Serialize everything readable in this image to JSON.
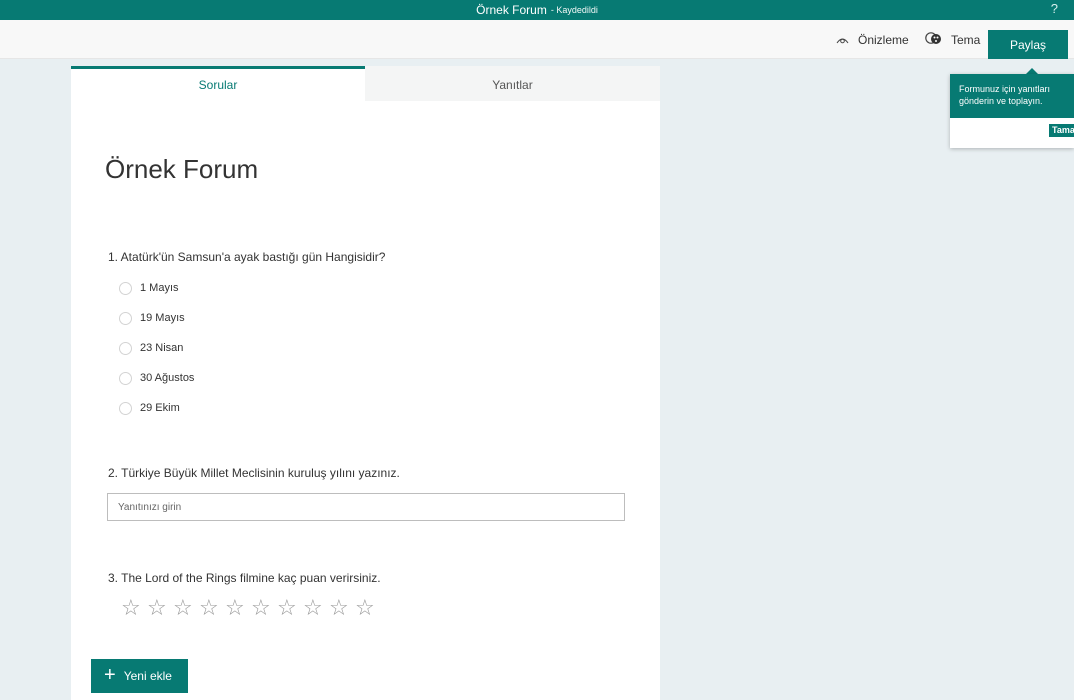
{
  "titlebar": {
    "title": "Örnek Forum",
    "status": "- Kaydedildi",
    "help": "?"
  },
  "toolbar": {
    "preview_label": "Önizleme",
    "theme_label": "Tema",
    "share_label": "Paylaş",
    "preview_icon": "eye-icon",
    "theme_icon": "palette-icon"
  },
  "tabs": {
    "questions": "Sorular",
    "responses": "Yanıtlar",
    "active": "Sorular"
  },
  "form": {
    "title": "Örnek Forum",
    "questions": [
      {
        "text": "1. Atatürk'ün Samsun'a ayak bastığı gün Hangisidir?",
        "type": "choice",
        "options": [
          "1 Mayıs",
          "19 Mayıs",
          "23 Nisan",
          "30 Ağustos",
          "29 Ekim"
        ]
      },
      {
        "text": "2. Türkiye Büyük Millet Meclisinin kuruluş yılını yazınız.",
        "type": "text",
        "placeholder": "Yanıtınızı girin",
        "value": ""
      },
      {
        "text": "3. The Lord of the Rings filmine kaç puan verirsiniz.",
        "type": "rating",
        "max_rating": 10,
        "rating": 0
      }
    ],
    "add_button": "Yeni ekle"
  },
  "callout": {
    "text_line1": "Formunuz için yanıtları",
    "text_line2": "gönderin ve toplayın.",
    "button": "Tamam"
  },
  "colors": {
    "accent": "#077a73",
    "background": "#e8eff2"
  }
}
